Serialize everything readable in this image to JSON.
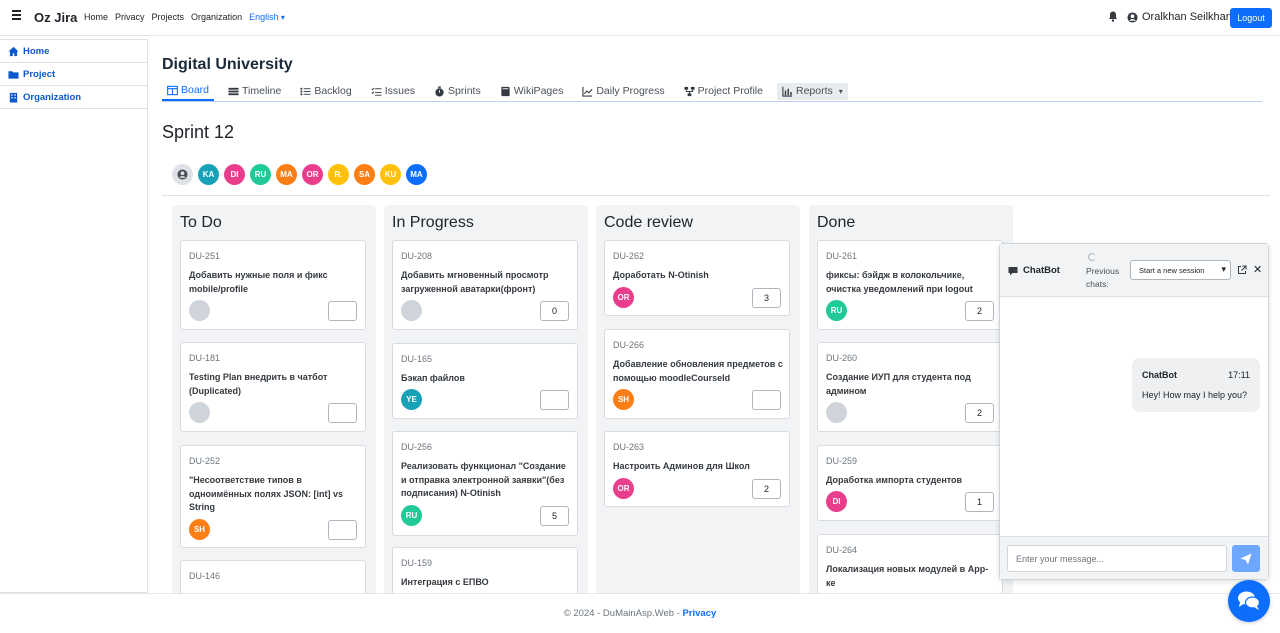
{
  "navbar": {
    "brand": "Oz Jira",
    "links": [
      "Home",
      "Privacy",
      "Projects",
      "Organization"
    ],
    "language": "English",
    "user_name": "Oralkhan Seilkhan",
    "logout_label": "Logout"
  },
  "sidebar": {
    "items": [
      {
        "label": "Home",
        "icon": "home-icon"
      },
      {
        "label": "Project",
        "icon": "folder-icon"
      },
      {
        "label": "Organization",
        "icon": "building-icon"
      }
    ]
  },
  "project": {
    "title": "Digital University",
    "tabs": [
      {
        "label": "Board",
        "icon": "board-icon",
        "active": true
      },
      {
        "label": "Timeline",
        "icon": "timeline-icon"
      },
      {
        "label": "Backlog",
        "icon": "backlog-icon"
      },
      {
        "label": "Issues",
        "icon": "issues-icon"
      },
      {
        "label": "Sprints",
        "icon": "sprints-icon"
      },
      {
        "label": "WikiPages",
        "icon": "book-icon"
      },
      {
        "label": "Daily Progress",
        "icon": "chart-line-icon"
      },
      {
        "label": "Project Profile",
        "icon": "sitemap-icon"
      },
      {
        "label": "Reports",
        "icon": "bar-chart-icon"
      }
    ]
  },
  "sprint": {
    "title": "Sprint 12",
    "members": [
      {
        "initials": "",
        "color": "#dee2e6"
      },
      {
        "initials": "KA",
        "color": "#17a2b8"
      },
      {
        "initials": "DI",
        "color": "#e83e8c"
      },
      {
        "initials": "RU",
        "color": "#20c997"
      },
      {
        "initials": "MA",
        "color": "#fd7e14"
      },
      {
        "initials": "OR",
        "color": "#e83e8c"
      },
      {
        "initials": "R.",
        "color": "#ffc107"
      },
      {
        "initials": "SA",
        "color": "#fd7e14"
      },
      {
        "initials": "KU",
        "color": "#ffc107"
      },
      {
        "initials": "MA",
        "color": "#0d6efd"
      }
    ]
  },
  "board": {
    "columns": [
      {
        "title": "To Do",
        "cards": [
          {
            "key": "DU-251",
            "title": "Добавить нужные поля и фикс mobile/profile",
            "assignee": "",
            "assignee_color": "#ced4da",
            "estimate": ""
          },
          {
            "key": "DU-181",
            "title": "Testing Plan внедрить в чатбот (Duplicated)",
            "assignee": "",
            "assignee_color": "#ced4da",
            "estimate": ""
          },
          {
            "key": "DU-252",
            "title": "\"Несоответствие типов в одноимённых полях JSON: [int] vs String",
            "assignee": "SH",
            "assignee_color": "#fd7e14",
            "estimate": ""
          },
          {
            "key": "DU-146",
            "title": "",
            "assignee": "",
            "assignee_color": "#ced4da",
            "estimate": ""
          }
        ]
      },
      {
        "title": "In Progress",
        "cards": [
          {
            "key": "DU-208",
            "title": "Добавить мгновенный просмотр загруженной аватарки(фронт)",
            "assignee": "",
            "assignee_color": "#ced4da",
            "estimate": "0"
          },
          {
            "key": "DU-165",
            "title": "Бэкап файлов",
            "assignee": "YE",
            "assignee_color": "#17a2b8",
            "estimate": ""
          },
          {
            "key": "DU-256",
            "title": "Реализовать функционал \"Создание и отправка электронной заявки\"(без подписания) N-Otinish",
            "assignee": "RU",
            "assignee_color": "#20c997",
            "estimate": "5"
          },
          {
            "key": "DU-159",
            "title": "Интеграция с ЕПВО",
            "assignee": "",
            "assignee_color": "#ced4da",
            "estimate": ""
          }
        ]
      },
      {
        "title": "Code review",
        "cards": [
          {
            "key": "DU-262",
            "title": "Доработать N-Otinish",
            "assignee": "OR",
            "assignee_color": "#e83e8c",
            "estimate": "3"
          },
          {
            "key": "DU-266",
            "title": "Добавление обновления предметов с помощью moodleCourseId",
            "assignee": "SH",
            "assignee_color": "#fd7e14",
            "estimate": ""
          },
          {
            "key": "DU-263",
            "title": "Настроить Админов для Школ",
            "assignee": "OR",
            "assignee_color": "#e83e8c",
            "estimate": "2"
          }
        ]
      },
      {
        "title": "Done",
        "cards": [
          {
            "key": "DU-261",
            "title": "фиксы: бэйдж в колокольчике, очистка уведомлений при logout",
            "assignee": "RU",
            "assignee_color": "#20c997",
            "estimate": "2"
          },
          {
            "key": "DU-260",
            "title": "Создание ИУП для студента под админом",
            "assignee": "",
            "assignee_color": "#ced4da",
            "estimate": "2"
          },
          {
            "key": "DU-259",
            "title": "Доработка импорта студентов",
            "assignee": "DI",
            "assignee_color": "#e83e8c",
            "estimate": "1"
          },
          {
            "key": "DU-264",
            "title": "Локализация новых модулей в App-ке",
            "assignee": "",
            "assignee_color": "#ced4da",
            "estimate": ""
          }
        ]
      }
    ]
  },
  "chatbot": {
    "title": "ChatBot",
    "previous_label": "Previous chats:",
    "session_select": "Start a new session",
    "messages": [
      {
        "sender": "ChatBot",
        "time": "17:11",
        "text": "Hey! How may I help you?"
      }
    ],
    "input_placeholder": "Enter your message..."
  },
  "footer": {
    "text": "© 2024 - DuMainAsp.Web - ",
    "privacy_link": "Privacy"
  },
  "colors": {
    "primary": "#0d6efd",
    "column_bg": "#f1f3f5"
  }
}
